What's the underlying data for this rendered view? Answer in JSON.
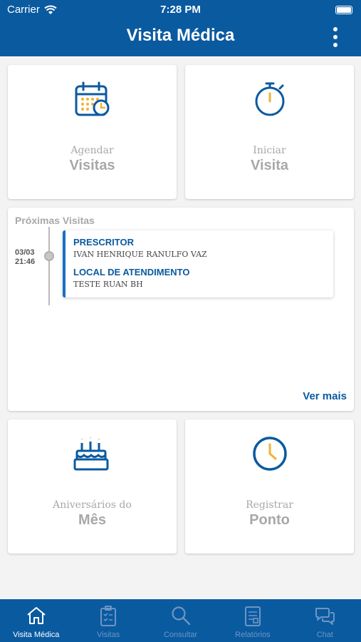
{
  "status_bar": {
    "carrier": "Carrier",
    "time": "7:28 PM"
  },
  "header": {
    "title": "Visita Médica",
    "menu_icon": "more-vertical-icon"
  },
  "tiles": {
    "schedule": {
      "small": "Agendar",
      "big": "Visitas",
      "icon": "calendar-icon"
    },
    "start": {
      "small": "Iniciar",
      "big": "Visita",
      "icon": "stopwatch-icon"
    },
    "birthdays": {
      "small": "Aniversários do",
      "big": "Mês",
      "icon": "cake-icon"
    },
    "clock_in": {
      "small": "Registrar",
      "big": "Ponto",
      "icon": "clock-icon"
    }
  },
  "upcoming": {
    "heading": "Próximas Visitas",
    "items": [
      {
        "date": "03/03",
        "time": "21:46",
        "prescriber_label": "PRESCRITOR",
        "prescriber": "IVAN HENRIQUE RANULFO VAZ",
        "location_label": "LOCAL DE ATENDIMENTO",
        "location": "TESTE RUAN BH"
      }
    ],
    "see_more": "Ver mais"
  },
  "tabs": [
    {
      "label": "Visita Médica",
      "icon": "home-icon",
      "active": true
    },
    {
      "label": "Visitas",
      "icon": "clipboard-icon",
      "active": false
    },
    {
      "label": "Consultar",
      "icon": "search-icon",
      "active": false
    },
    {
      "label": "Relatórios",
      "icon": "report-icon",
      "active": false
    },
    {
      "label": "Chat",
      "icon": "chat-icon",
      "active": false
    }
  ],
  "colors": {
    "primary": "#0a5aa0",
    "accent": "#f2b233",
    "muted": "#a8a8a8"
  }
}
